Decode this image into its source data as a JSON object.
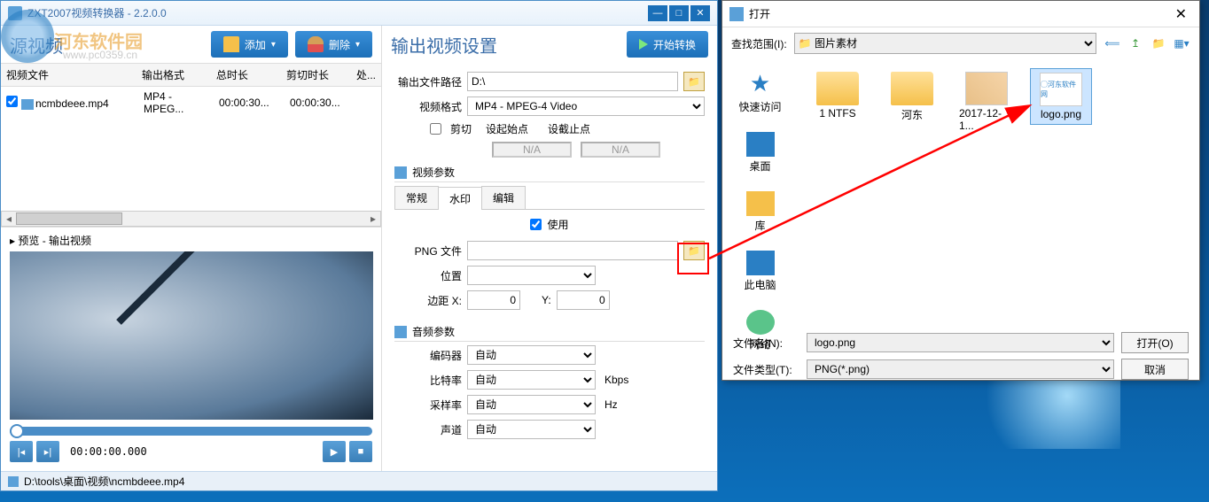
{
  "app": {
    "title": "ZXT2007视频转换器 - 2.2.0.0",
    "watermark_site": "河东软件园",
    "watermark_url": "www.pc0359.cn"
  },
  "sourcePane": {
    "heading": "源视频",
    "addBtn": "添加",
    "deleteBtn": "删除",
    "columns": {
      "file": "视频文件",
      "format": "输出格式",
      "duration": "总时长",
      "cut": "剪切时长",
      "action": "处..."
    },
    "row": {
      "filename": "ncmbdeee.mp4",
      "format": "MP4 - MPEG...",
      "duration": "00:00:30...",
      "cut": "00:00:30..."
    },
    "previewLabel": "▸ 预览 - 输出视频",
    "playerTime": "00:00:00.000"
  },
  "outputPane": {
    "heading": "输出视频设置",
    "startBtn": "开始转换",
    "outputPath": {
      "label": "输出文件路径",
      "value": "D:\\"
    },
    "videoFormat": {
      "label": "视频格式",
      "value": "MP4 - MPEG-4 Video"
    },
    "cutCheck": "剪切",
    "startPoint": "设起始点",
    "endPoint": "设截止点",
    "na": "N/A",
    "videoParams": "视频参数",
    "tabs": {
      "general": "常规",
      "watermark": "水印",
      "edit": "编辑"
    },
    "useCheck": "使用",
    "pngFile": {
      "label": "PNG 文件"
    },
    "position": {
      "label": "位置"
    },
    "marginX": {
      "label": "边距 X:",
      "value": "0"
    },
    "marginY": {
      "label": "Y:",
      "value": "0"
    },
    "audioParams": "音频参数",
    "encoder": {
      "label": "编码器",
      "value": "自动"
    },
    "bitrate": {
      "label": "比特率",
      "value": "自动",
      "unit": "Kbps"
    },
    "sampleRate": {
      "label": "采样率",
      "value": "自动",
      "unit": "Hz"
    },
    "channel": {
      "label": "声道",
      "value": "自动"
    }
  },
  "statusBar": {
    "path": "D:\\tools\\桌面\\视频\\ncmbdeee.mp4"
  },
  "dialog": {
    "title": "打开",
    "lookIn": {
      "label": "查找范围(I):",
      "value": "图片素材"
    },
    "side": {
      "quick": "快速访问",
      "desktop": "桌面",
      "lib": "库",
      "pc": "此电脑",
      "net": "网络"
    },
    "files": {
      "f1": "1 NTFS",
      "f2": "河东",
      "f3": "2017-12-1...",
      "f4": "logo.png"
    },
    "filename": {
      "label": "文件名(N):",
      "value": "logo.png"
    },
    "filetype": {
      "label": "文件类型(T):",
      "value": "PNG(*.png)"
    },
    "openBtn": "打开(O)",
    "cancelBtn": "取消"
  }
}
